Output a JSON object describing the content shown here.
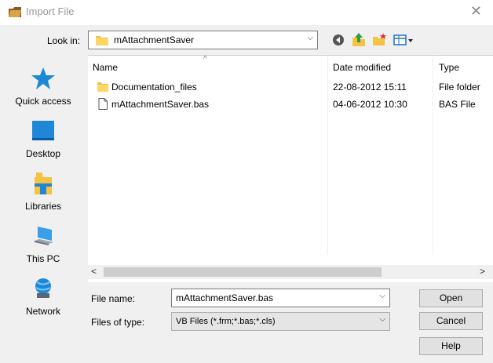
{
  "window": {
    "title": "Import File",
    "close_glyph": "✕"
  },
  "lookin": {
    "label": "Look in:",
    "value": "mAttachmentSaver"
  },
  "toolbar": [
    "back-icon",
    "up-folder-icon",
    "new-folder-icon",
    "view-menu-icon"
  ],
  "places": [
    {
      "label": "Quick access",
      "icon": "star-icon"
    },
    {
      "label": "Desktop",
      "icon": "desktop-icon"
    },
    {
      "label": "Libraries",
      "icon": "libraries-icon"
    },
    {
      "label": "This PC",
      "icon": "computer-icon"
    },
    {
      "label": "Network",
      "icon": "network-icon"
    }
  ],
  "columns": {
    "name": "Name",
    "date": "Date modified",
    "type": "Type"
  },
  "files": [
    {
      "name": "Documentation_files",
      "date": "22-08-2012 15:11",
      "type": "File folder",
      "icon": "folder-icon"
    },
    {
      "name": "mAttachmentSaver.bas",
      "date": "04-06-2012 10:30",
      "type": "BAS File",
      "icon": "file-icon"
    }
  ],
  "filename": {
    "label": "File name:",
    "value": "mAttachmentSaver.bas"
  },
  "filetype": {
    "label": "Files of type:",
    "value": "VB Files (*.frm;*.bas;*.cls)"
  },
  "buttons": {
    "open": "Open",
    "cancel": "Cancel",
    "help": "Help"
  },
  "colors": {
    "folder": "#f5c242",
    "accent": "#1e88d6"
  }
}
